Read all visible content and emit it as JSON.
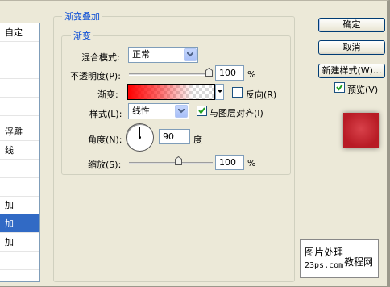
{
  "style_list": {
    "items": [
      "自定",
      "",
      "",
      "",
      "",
      "浮雕",
      "线",
      "",
      "",
      "加",
      "加",
      "加",
      ""
    ],
    "selected_index": 10
  },
  "gradient_overlay": {
    "title": "渐变叠加",
    "sub_group_title": "渐变",
    "blend_mode_label": "混合模式:",
    "blend_mode_value": "正常",
    "opacity_label": "不透明度(P):",
    "opacity_value": "100",
    "opacity_unit": "%",
    "opacity_level": 1.0,
    "gradient_label": "渐变:",
    "reverse_label": "反向(R)",
    "reverse_checked": false,
    "style_label": "样式(L):",
    "style_value": "线性",
    "align_label": "与图层对齐(I)",
    "align_checked": true,
    "angle_label": "角度(N):",
    "angle_value": "90",
    "angle_unit": "度",
    "scale_label": "缩放(S):",
    "scale_value": "100",
    "scale_unit": "%",
    "scale_level": 0.5
  },
  "buttons": {
    "ok": "确定",
    "cancel": "取消",
    "new_style": "新建样式(W)...",
    "preview_label": "预览(V)",
    "preview_checked": true
  },
  "watermark": {
    "line1": "图片处理",
    "line2": "23ps.com",
    "line3": "教程网"
  },
  "colors": {
    "accent_blue": "#0046d5",
    "selection": "#316ac5",
    "preview_red": "#c8232d",
    "gradient_red": "#ff0000"
  }
}
